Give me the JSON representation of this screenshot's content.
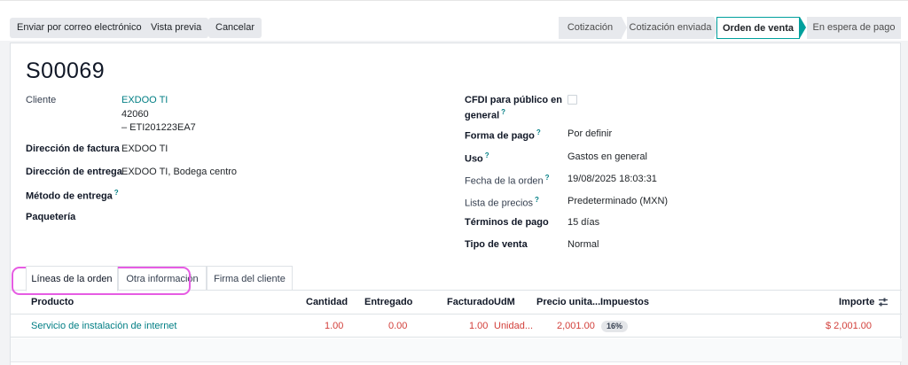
{
  "toolbar": {
    "send_email": "Enviar por correo electrónico",
    "preview": "Vista previa",
    "cancel": "Cancelar"
  },
  "status": {
    "stages": [
      "Cotización",
      "Cotización enviada",
      "Orden de venta",
      "En espera de pago"
    ],
    "active": "Orden de venta"
  },
  "record": {
    "name": "S00069"
  },
  "left_fields": {
    "cliente_label": "Cliente",
    "cliente_name": "EXDOO TI",
    "cliente_line2": "42060",
    "cliente_line3": "– ETI201223EA7",
    "factura_label": "Dirección de factura",
    "factura_value": "EXDOO TI",
    "entrega_label": "Dirección de entrega",
    "entrega_value": "EXDOO TI, Bodega centro",
    "metodo_label": "Método de entrega",
    "paqueteria_label": "Paquetería"
  },
  "right_fields": {
    "cfdi_label_1": "CFDI para público en",
    "cfdi_label_2": "general",
    "forma_pago_label": "Forma de pago",
    "forma_pago_value": "Por definir",
    "uso_label": "Uso",
    "uso_value": "Gastos en general",
    "fecha_label": "Fecha de la orden",
    "fecha_value": "19/08/2025 18:03:31",
    "lista_label": "Lista de precios",
    "lista_value": "Predeterminado (MXN)",
    "terminos_label": "Términos de pago",
    "terminos_value": "15 días",
    "tipo_label": "Tipo de venta",
    "tipo_value": "Normal",
    "help_mark": "?"
  },
  "tabs": [
    "Líneas de la orden",
    "Otra información",
    "Firma del cliente"
  ],
  "table": {
    "headers": {
      "producto": "Producto",
      "cantidad": "Cantidad",
      "entregado": "Entregado",
      "facturado": "Facturado",
      "udm": "UdM",
      "precio": "Precio unita...",
      "impuestos": "Impuestos",
      "importe": "Importe"
    },
    "rows": [
      {
        "producto": "Servicio de instalación de internet",
        "cantidad": "1.00",
        "entregado": "0.00",
        "facturado": "1.00",
        "udm": "Unidad...",
        "precio": "2,001.00",
        "impuestos": "16%",
        "importe": "$ 2,001.00"
      }
    ]
  },
  "colors": {
    "accent": "#017e84",
    "active_stage_border": "#00a09d",
    "negative_text": "#d23f3a",
    "highlight": "#e65ce3"
  },
  "icons": {
    "column_settings": "sliders-icon"
  }
}
